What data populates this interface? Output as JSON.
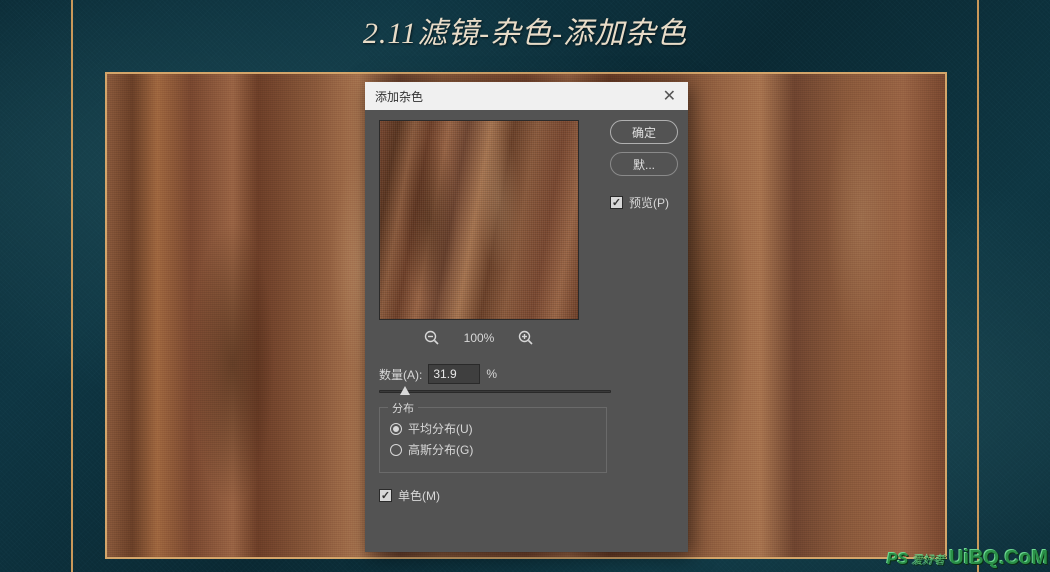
{
  "title": "2.11滤镜-杂色-添加杂色",
  "dialog": {
    "title": "添加杂色",
    "close_glyph": "✕",
    "zoom_level": "100%",
    "amount_label": "数量(A):",
    "amount_value": "31.9",
    "amount_unit": "%",
    "distribution": {
      "legend": "分布",
      "uniform_label": "平均分布(U)",
      "gaussian_label": "高斯分布(G)",
      "selected": "uniform"
    },
    "monochrome_label": "单色(M)",
    "monochrome_checked": true,
    "buttons": {
      "ok": "确定",
      "cancel": "默..."
    },
    "preview_label": "预览(P)",
    "preview_checked": true
  },
  "watermark": {
    "ps": "PS",
    "cn": "爱好者",
    "site": "UiBQ.CoM"
  }
}
